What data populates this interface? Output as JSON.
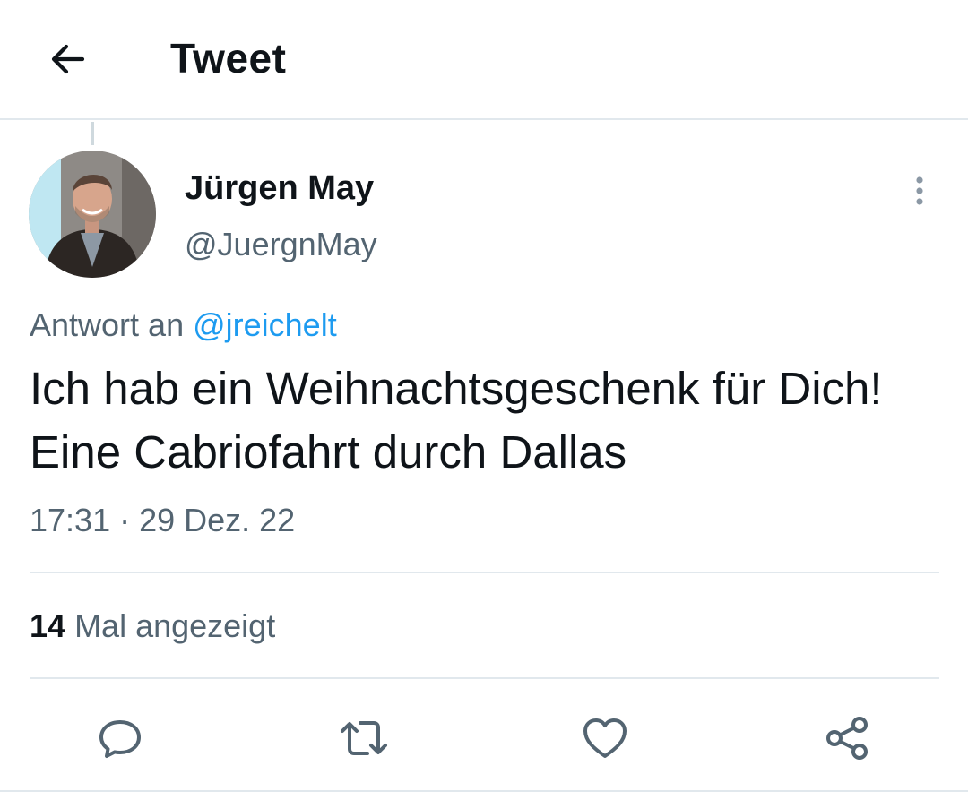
{
  "header": {
    "title": "Tweet",
    "back_icon": "arrow-left-icon"
  },
  "author": {
    "display_name": "Jürgen May",
    "handle": "@JuergnMay",
    "avatar_icon": "user-avatar"
  },
  "tweet": {
    "reply_prefix": "Antwort an",
    "reply_to": "@jreichelt",
    "text": "Ich hab ein Weihnachtsgeschenk für Dich! Eine Cabriofahrt durch Dallas",
    "timestamp": "17:31 · 29 Dez. 22",
    "views_count": "14",
    "views_label": "Mal angezeigt"
  },
  "actions": {
    "icons": [
      "reply-icon",
      "retweet-icon",
      "like-icon",
      "share-icon"
    ]
  },
  "colors": {
    "text": "#0f1419",
    "muted": "#536471",
    "link": "#1d9bf0",
    "divider": "#e1e8ed"
  }
}
